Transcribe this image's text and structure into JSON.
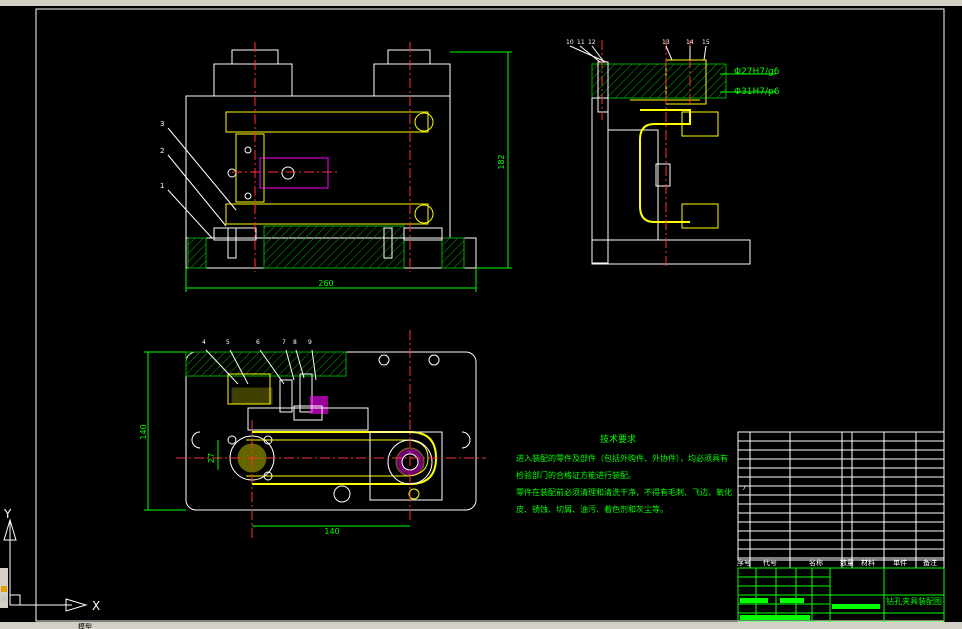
{
  "colors": {
    "background": "#000000",
    "border": "#ffffff",
    "body": "#ffffff",
    "center_line": "#ff3030",
    "dimension": "#00ff00",
    "part": "#ffff00",
    "hatch": "#00cc00",
    "accent": "#ff00ff",
    "cyan": "#00ffff"
  },
  "views": {
    "front": {
      "dim_width": "260",
      "dim_height": "182",
      "balloons": [
        "3",
        "2",
        "1"
      ]
    },
    "side": {
      "balloons": [
        "10",
        "11",
        "12",
        "13",
        "14",
        "15"
      ],
      "fit1": "Φ27H7/g6",
      "fit2": "Φ31H7/p6"
    },
    "top": {
      "dim_width": "140",
      "dim_height": "140",
      "dim_small": "27",
      "balloons": [
        "4",
        "5",
        "6",
        "7",
        "8",
        "9"
      ]
    }
  },
  "notes": {
    "title": "技术要求",
    "lines": [
      "进入装配的零件及部件（包括外购件、外协件），均必须具有",
      "检验部门的合格证方能进行装配。",
      "零件在装配前必须清理和清洗干净，不得有毛刺、飞边、氧化",
      "皮、锈蚀、切屑、油污、着色剂和灰尘等。"
    ]
  },
  "title_block": {
    "headers": [
      "序号",
      "代号",
      "名称",
      "数量",
      "材料",
      "单件",
      "备注"
    ],
    "drawing_name": "钻孔夹具装配图",
    "row_count": "7"
  },
  "ucs": {
    "x_label": "X",
    "y_label": "Y"
  },
  "status": {
    "tab_text": "模型"
  }
}
